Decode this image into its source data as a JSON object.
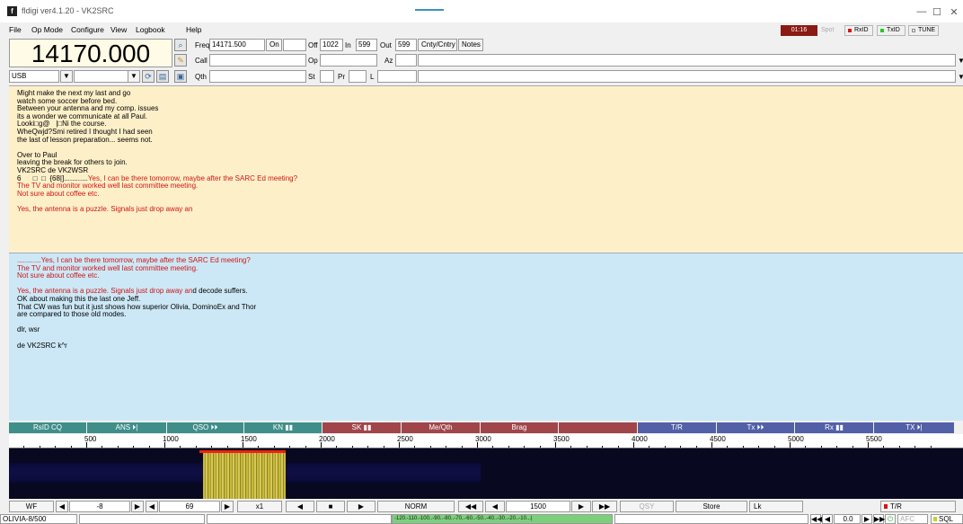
{
  "window": {
    "title": "fldigi ver4.1.20 - VK2SRC",
    "icon": "fldigi-app-icon",
    "minimize": "—",
    "maximize": "☐",
    "close": "✕"
  },
  "menu": [
    "File",
    "Op Mode",
    "Configure",
    "View",
    "Logbook",
    "Help"
  ],
  "indicators": {
    "clock": "01:16",
    "spot": "Spot",
    "rxid": "RxID",
    "txid": "TxID",
    "tune": "TUNE"
  },
  "rig": {
    "frequency": "14170.000",
    "mode": "USB"
  },
  "log": {
    "freq_label": "Freq",
    "freq_value": "14171.500",
    "on_label": "On",
    "on_value": "",
    "off_label": "Off",
    "off_value": "1022",
    "in_label": "In",
    "in_value": "599",
    "out_label": "Out",
    "out_value": "599",
    "cnty_label": "Cnty/Cntry",
    "notes_label": "Notes",
    "call_label": "Call",
    "call_value": "",
    "op_label": "Op",
    "op_value": "",
    "az_label": "Az",
    "az_value": "",
    "qth_label": "Qth",
    "qth_value": "",
    "st_label": "St",
    "st_value": "",
    "pr_label": "Pr",
    "pr_value": "",
    "l_label": "L",
    "l_value": ""
  },
  "rx_text": {
    "black1": "Might make the next my last and go\nwatch some soccer before bed.\nBetween your antenna and my comp. issues\nits a wonder we communicate at all Paul.\nLooki□g@   |□Ni the course.\nWheQwjd?Smi retired I thought I had seen\nthe last of lesson preparation... seems not.\n\nOver to Paul\nleaving the break for others to join.\nVK2SRC de VK2WSR\n",
    "garble": "6      □  □  {68|]............",
    "red1": "Yes, I can be there tomorrow, maybe after the SARC Ed meeting?\nThe TV and monitor worked well last committee meeting.\nNot sure about coffee etc.\n\nYes, the antenna is a puzzle. Signals just drop away an"
  },
  "tx_text": {
    "red": "............Yes, I can be there tomorrow, maybe after the SARC Ed meeting?\nThe TV and monitor worked well last committee meeting.\nNot sure about coffee etc.\n\nYes, the antenna is a puzzle. Signals just drop away an",
    "black_tail": "d decode suffers.",
    "black": "OK about making this the last one Jeff.\nThat CW was fun but it just shows how superior Olivia, DominoEx and Thor\nare compared to those old modes.\n\ndlr, wsr\n\nde VK2SRC k^r"
  },
  "macros": [
    {
      "label": "RsID CQ",
      "color": "#3f8e8a"
    },
    {
      "label": "ANS ⏵|",
      "color": "#3f8e8a"
    },
    {
      "label": "QSO ⏵⏵",
      "color": "#3f8e8a"
    },
    {
      "label": "KN ▮▮",
      "color": "#3f8e8a"
    },
    {
      "label": "SK ▮▮",
      "color": "#a0454a"
    },
    {
      "label": "Me/Qth",
      "color": "#a0454a"
    },
    {
      "label": "Brag",
      "color": "#a0454a"
    },
    {
      "label": "",
      "color": "#a0454a"
    },
    {
      "label": "T/R",
      "color": "#5260a8"
    },
    {
      "label": "Tx ⏵⏵",
      "color": "#5260a8"
    },
    {
      "label": "Rx ▮▮",
      "color": "#5260a8"
    },
    {
      "label": "TX ⏵|",
      "color": "#5260a8"
    }
  ],
  "scale_ticks": [
    "500",
    "1000",
    "1500",
    "2000",
    "2500",
    "3000",
    "3500",
    "4000",
    "4500",
    "5000",
    "5500"
  ],
  "controls": {
    "wf": "WF",
    "level": "-8",
    "range": "69",
    "zoom": "x1",
    "norm": "NORM",
    "cursor": "1500",
    "qsy": "QSY",
    "store": "Store",
    "lk": "Lk",
    "tr": "T/R"
  },
  "status": {
    "mode": "OLIVIA-8/500",
    "meter": "-120.-110.-100..-90..-80..-70..-60..-50..-40..-30..-20..-10...|",
    "offset": "0.0",
    "afc": "AFC",
    "sql": "SQL"
  }
}
